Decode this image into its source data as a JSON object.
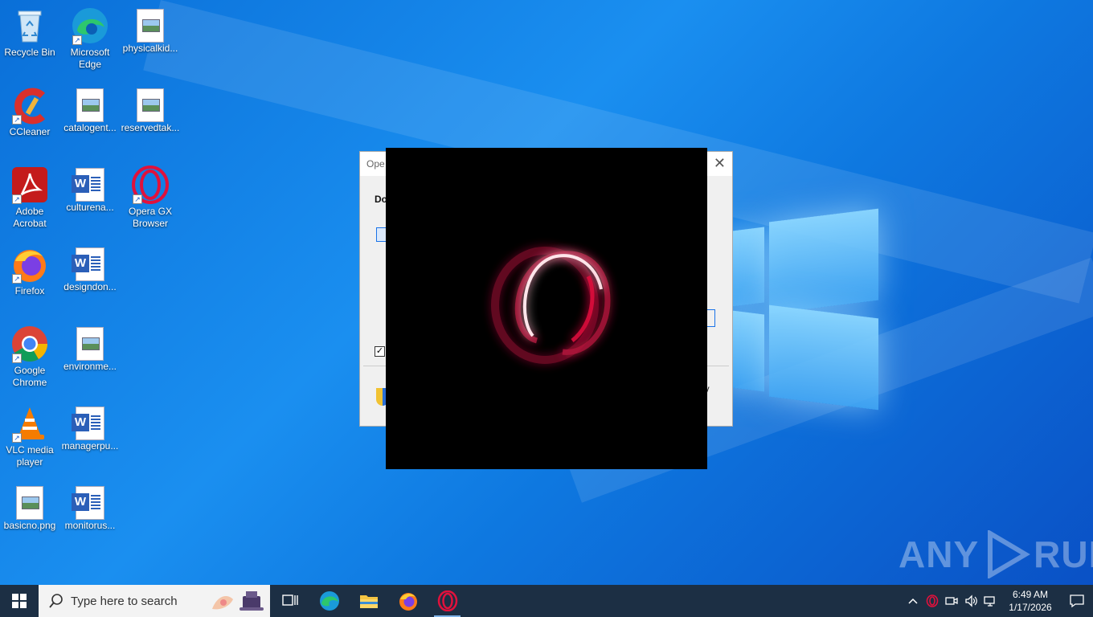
{
  "desktop": {
    "icons": [
      {
        "label": "Recycle Bin",
        "type": "recycle"
      },
      {
        "label": "Microsoft Edge",
        "type": "edge"
      },
      {
        "label": "physicalkid...",
        "type": "image"
      },
      {
        "label": "CCleaner",
        "type": "ccleaner"
      },
      {
        "label": "catalogent...",
        "type": "image"
      },
      {
        "label": "reservedtak...",
        "type": "image"
      },
      {
        "label": "Adobe Acrobat",
        "type": "acrobat"
      },
      {
        "label": "culturena...",
        "type": "word"
      },
      {
        "label": "Opera GX Browser",
        "type": "opera"
      },
      {
        "label": "Firefox",
        "type": "firefox"
      },
      {
        "label": "designdon...",
        "type": "word"
      },
      {
        "label": "Google Chrome",
        "type": "chrome"
      },
      {
        "label": "environme...",
        "type": "image"
      },
      {
        "label": "VLC media player",
        "type": "vlc"
      },
      {
        "label": "managerpu...",
        "type": "word"
      },
      {
        "label": "basicno.png",
        "type": "image"
      },
      {
        "label": "monitorus...",
        "type": "word"
      }
    ]
  },
  "dialog": {
    "title_fragment": "Ope",
    "heading_fragment": "Do",
    "side_text_fragment": "ly",
    "checkbox_mark": "✓",
    "close_glyph": "✕"
  },
  "watermark": {
    "left": "ANY",
    "right": "RUN"
  },
  "taskbar": {
    "search_placeholder": "Type here to search",
    "pinned": [
      "task-view",
      "edge",
      "file-explorer",
      "firefox",
      "opera"
    ],
    "tray": {
      "chevron": "^"
    },
    "clock": {
      "time": "6:49 AM",
      "date": "1/17/2026"
    }
  },
  "colors": {
    "taskbar": "#1c2f44",
    "opera_red": "#e0113c",
    "desktop_blue": "#0e78e0"
  }
}
